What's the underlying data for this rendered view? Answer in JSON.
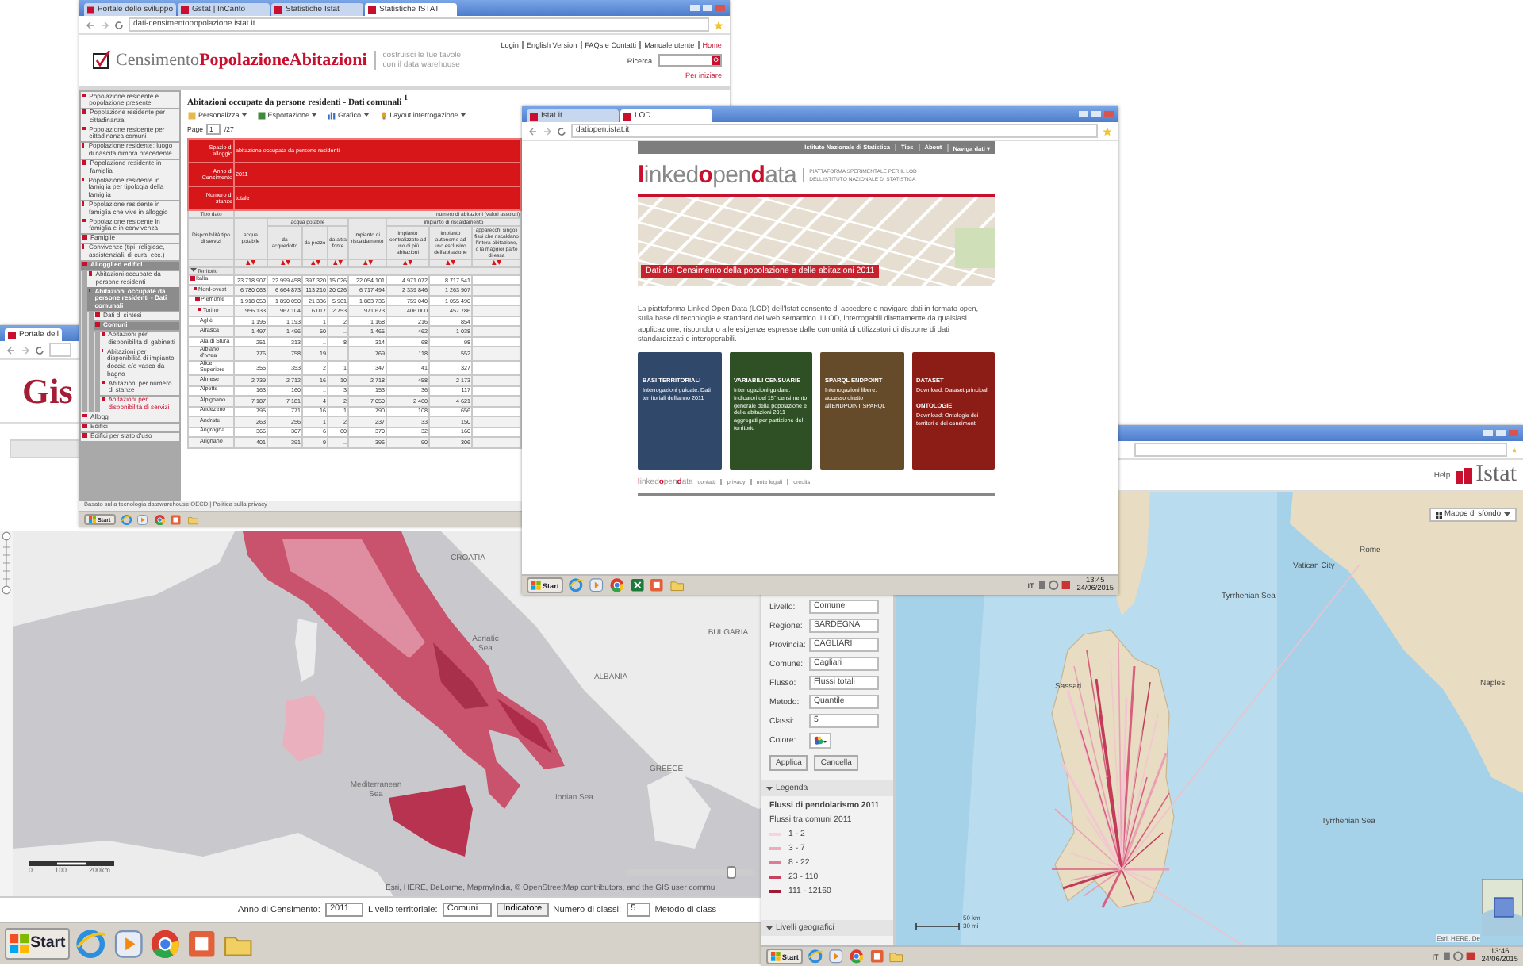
{
  "windows": [
    {
      "kind": "italy",
      "tabs": [
        {
          "label": "Portale dell",
          "selected": true
        }
      ],
      "heading": "Gis",
      "map_labels": [
        "CROATIA",
        "Adriatic Sea",
        "ALBANIA",
        "BULGARIA",
        "Mediterranean Sea",
        "Ionian Sea",
        "GREECE"
      ],
      "scale": [
        "0",
        "100",
        "200km"
      ],
      "opacity_slider": {
        "level": 0.82
      },
      "attribution": "Esri, HERE, DeLorme, MapmyIndia, © OpenStreetMap contributors, and the GIS user commu",
      "controls": [
        {
          "kind": "label",
          "text": "Anno di Censimento:"
        },
        {
          "kind": "select",
          "text": "2011"
        },
        {
          "kind": "label",
          "text": "Livello territoriale:"
        },
        {
          "kind": "select",
          "text": "Comuni"
        },
        {
          "kind": "button",
          "text": "Indicatore"
        },
        {
          "kind": "label",
          "text": "Numero di classi:"
        },
        {
          "kind": "select",
          "text": "5"
        },
        {
          "kind": "label",
          "text": "Metodo di class"
        }
      ],
      "taskbar": {
        "start": "Start",
        "apps": [
          {
            "kind": "ie"
          },
          {
            "kind": "media"
          },
          {
            "kind": "chrome"
          },
          {
            "kind": "ppt"
          },
          {
            "kind": "folder"
          }
        ]
      }
    },
    {
      "kind": "flows",
      "header_link": "Help",
      "logo": "Istat",
      "basemap_button": "Mappe di sfondo",
      "fields": [
        {
          "label": "Livello:",
          "value": "Comune"
        },
        {
          "label": "Regione:",
          "value": "SARDEGNA"
        },
        {
          "label": "Provincia:",
          "value": "CAGLIARI"
        },
        {
          "label": "Comune:",
          "value": "Cagliari"
        },
        {
          "label": "Flusso:",
          "value": "Flussi totali"
        },
        {
          "label": "Metodo:",
          "value": "Quantile"
        },
        {
          "label": "Classi:",
          "value": "5"
        }
      ],
      "color_label": "Colore:",
      "buttons": [
        "Applica",
        "Cancella"
      ],
      "legend": {
        "toggle": "Legenda",
        "title": "Flussi di pendolarismo 2011",
        "subtitle": "Flussi tra comuni 2011",
        "classes": [
          {
            "label": "1 - 2",
            "color": "#f7d3dc"
          },
          {
            "label": "3 - 7",
            "color": "#efabbb"
          },
          {
            "label": "8 - 22",
            "color": "#e07b93"
          },
          {
            "label": "23 - 110",
            "color": "#c6425e"
          },
          {
            "label": "111 - 12160",
            "color": "#9c1a37"
          }
        ]
      },
      "levels_toggle": "Livelli geografici",
      "map_labels": [
        "Vatican City",
        "Rome",
        "Naples",
        "Tyrrhenian Sea",
        "Tyrrhenian Sea",
        "Sassari"
      ],
      "scale": [
        "50 km",
        "30 mi"
      ],
      "attribution": "Esri, HERE, De",
      "taskbar": {
        "start": "Start",
        "apps": [
          {
            "kind": "ie"
          },
          {
            "kind": "media"
          },
          {
            "kind": "chrome"
          },
          {
            "kind": "ppt"
          },
          {
            "kind": "folder"
          }
        ],
        "language": "IT",
        "time": "13:46",
        "date": "24/06/2015"
      }
    },
    {
      "kind": "census",
      "tabs": [
        {
          "label": "Portale dello sviluppo",
          "selected": false
        },
        {
          "label": "Gstat | InCanto",
          "selected": false
        },
        {
          "label": "Statistiche Istat",
          "selected": false
        },
        {
          "label": "Statistiche ISTAT",
          "selected": true
        }
      ],
      "url": "dati-censimentopopolazione.istat.it",
      "logo": "Censimento**PopolazioneAbitazioni**",
      "tagline": "costruisci le tue tavole con il data warehouse",
      "top_links": [
        "Login",
        "English Version",
        "FAQs e Contatti",
        "Manuale utente",
        "Home"
      ],
      "search_label": "Ricerca",
      "start_link": "Per iniziare",
      "sidebar": [
        {
          "label": "Popolazione residente e popolazione presente",
          "selected": false
        },
        {
          "label": "Popolazione residente per cittadinanza",
          "selected": false
        },
        {
          "label": "Popolazione residente per cittadinanza comuni",
          "selected": false
        },
        {
          "label": "Popolazione residente: luogo di nascita dimora precedente",
          "selected": false
        },
        {
          "label": "Popolazione residente in famiglia",
          "selected": false
        },
        {
          "label": "Popolazione residente in famiglia per tipologia della famiglia",
          "selected": false
        },
        {
          "label": "Popolazione residente in famiglia che vive in alloggio",
          "selected": false
        },
        {
          "label": "Popolazione residente in famiglia e in convivenza",
          "selected": false
        },
        {
          "label": "Famiglie",
          "selected": false
        },
        {
          "label": "Convivenze (tipi, religiose, assistenziali, di cura, ecc.)",
          "selected": false
        },
        {
          "label": "Alloggi ed edifici",
          "selected": false,
          "children": [
            {
              "label": "Abitazioni occupate da persone residenti",
              "selected": false
            },
            {
              "label": "Abitazioni occupate da persone residenti - Dati comunali",
              "selected": false,
              "children": [
                {
                  "label": "Dati di sintesi",
                  "selected": false
                },
                {
                  "label": "Comuni",
                  "selected": false,
                  "children": [
                    {
                      "label": "Abitazioni per disponibilità di gabinetti",
                      "selected": false
                    },
                    {
                      "label": "Abitazioni per disponibilità di impianto doccia e/o vasca da bagno",
                      "selected": false
                    },
                    {
                      "label": "Abitazioni per numero di stanze",
                      "selected": false
                    },
                    {
                      "label": "Abitazioni per disponibilità di servizi",
                      "selected": true
                    }
                  ]
                }
              ]
            }
          ]
        },
        {
          "label": "Alloggi",
          "selected": false
        },
        {
          "label": "Edifici",
          "selected": false
        },
        {
          "label": "Edifici per stato d'uso",
          "selected": false
        }
      ],
      "title": "Abitazioni occupate da persone residenti - Dati comunali $^{1}$",
      "toolbar": [
        "Personalizza",
        "Esportazione",
        "Grafico",
        "Layout interrogazione"
      ],
      "page_label": "Page",
      "page": "1",
      "page_total": "/27",
      "filters": [
        {
          "label": "Spazio di alloggio",
          "value": "abitazione occupata da persone residenti"
        },
        {
          "label": "Anno di Censimento",
          "value": "2011"
        },
        {
          "label": "Numero di stanze",
          "value": "totale"
        }
      ],
      "data_type": {
        "label": "Tipo dato",
        "value": "numero di abitazioni (valori assoluti)"
      },
      "row_header": "Disponibilità tipo di servizi",
      "header": [
        {
          "kind": "single",
          "label": "acqua potabile"
        },
        {
          "kind": "group",
          "label": "acqua potabile",
          "columns": [
            "da acquedotto",
            "da pozzo",
            "da altra fonte"
          ]
        },
        {
          "kind": "single",
          "label": "impianto di riscaldamento"
        },
        {
          "kind": "group",
          "label": "impianto di riscaldamento",
          "columns": [
            "impianto centralizzato ad uso di più abitazioni",
            "impianto autonomo ad uso esclusivo dell'abitazione",
            "apparecchi singoli fissi che riscaldano l'intera abitazione, o la maggior parte di essa"
          ]
        }
      ],
      "territory_label": "Territorio",
      "rows": [
        {
          "name": "Italia",
          "values": [
            "23 718 907",
            "22 999 458",
            "397 320",
            "15 026",
            "22 054 101",
            "4 971 072",
            "8 717 541"
          ],
          "children": [
            {
              "name": "Nord-ovest",
              "values": [
                "6 780 063",
                "6 664 873",
                "113 210",
                "20 026",
                "6 717 494",
                "2 339 846",
                "1 263 907"
              ],
              "children": [
                {
                  "name": "Piemonte",
                  "values": [
                    "1 918 053",
                    "1 890 050",
                    "21 336",
                    "5 961",
                    "1 883 736",
                    "759 040",
                    "1 055 490"
                  ],
                  "children": [
                    {
                      "name": "Torino",
                      "values": [
                        "956 133",
                        "967 104",
                        "6 017",
                        "2 753",
                        "971 673",
                        "406 000",
                        "457 786"
                      ],
                      "children": [
                        {
                          "name": "Agliè",
                          "values": [
                            "1 195",
                            "1 193",
                            "1",
                            "2",
                            "1 168",
                            "216",
                            "854"
                          ]
                        },
                        {
                          "name": "Airasca",
                          "values": [
                            "1 497",
                            "1 496",
                            "50",
                            "..",
                            "1 465",
                            "462",
                            "1 038"
                          ]
                        },
                        {
                          "name": "Ala di Stura",
                          "values": [
                            "251",
                            "313",
                            "..",
                            "8",
                            "314",
                            "68",
                            "98"
                          ]
                        },
                        {
                          "name": "Albiano d'Ivrea",
                          "values": [
                            "776",
                            "758",
                            "19",
                            "..",
                            "769",
                            "118",
                            "552"
                          ]
                        },
                        {
                          "name": "Alice Superiore",
                          "values": [
                            "355",
                            "353",
                            "2",
                            "1",
                            "347",
                            "41",
                            "327"
                          ]
                        },
                        {
                          "name": "Almese",
                          "values": [
                            "2 739",
                            "2 712",
                            "16",
                            "10",
                            "2 718",
                            "458",
                            "2 173"
                          ]
                        },
                        {
                          "name": "Alpette",
                          "values": [
                            "163",
                            "160",
                            "..",
                            "3",
                            "153",
                            "36",
                            "117"
                          ]
                        },
                        {
                          "name": "Alpignano",
                          "values": [
                            "7 187",
                            "7 181",
                            "4",
                            "2",
                            "7 050",
                            "2 460",
                            "4 621"
                          ]
                        },
                        {
                          "name": "Andezeno",
                          "values": [
                            "795",
                            "771",
                            "16",
                            "1",
                            "790",
                            "108",
                            "656"
                          ]
                        },
                        {
                          "name": "Andrate",
                          "values": [
                            "263",
                            "256",
                            "1",
                            "2",
                            "237",
                            "33",
                            "150"
                          ]
                        },
                        {
                          "name": "Angrogna",
                          "values": [
                            "366",
                            "307",
                            "6",
                            "60",
                            "370",
                            "32",
                            "160"
                          ]
                        },
                        {
                          "name": "Arignano",
                          "values": [
                            "401",
                            "391",
                            "9",
                            "..",
                            "396",
                            "90",
                            "306"
                          ]
                        }
                      ]
                    }
                  ]
                }
              ]
            }
          ]
        }
      ],
      "footer": "Basato sulla tecnologia datawarehouse OECD | Politica sulla privacy",
      "taskbar": {
        "start": "Start",
        "apps": [
          {
            "kind": "ie"
          },
          {
            "kind": "media"
          },
          {
            "kind": "chrome"
          },
          {
            "kind": "ppt"
          },
          {
            "kind": "folder"
          }
        ]
      }
    },
    {
      "kind": "lod",
      "tabs": [
        {
          "label": "Istat.it",
          "selected": false
        },
        {
          "label": "LOD",
          "selected": true
        }
      ],
      "url": "datiopen.istat.it",
      "nav": [
        "Istituto Nazionale di Statistica",
        "Tips",
        "About",
        "Naviga dati ▾"
      ],
      "logo": "**l**inked**o**pen**d**ata",
      "tagline": "PIATTAFORMA SPERIMENTALE PER IL LOD DELL'ISTITUTO NAZIONALE DI STATISTICA",
      "banner": "Dati del Censimento della popolazione e delle abitazioni 2011",
      "intro": "La piattaforma Linked Open Data (LOD) dell'Istat consente di accedere e navigare dati in formato open, sulla base di tecnologie e standard del web semantico. I LOD, interrogabili direttamente da qualsiasi applicazione, rispondono alle esigenze espresse dalle comunità di utilizzatori di disporre di dati standardizzati e interoperabili.",
      "cards": [
        {
          "color": "#30486a",
          "sections": [
            {
              "title": "BASI TERRITORIALI",
              "text": "Interrogazioni guidate: Dati territoriali dell'anno 2011"
            }
          ]
        },
        {
          "color": "#2f4f24",
          "sections": [
            {
              "title": "VARIABILI CENSUARIE",
              "text": "Interrogazioni guidate: Indicatori del 15° censimento generale della popolazione e delle abitazioni 2011 aggregati per partizione del territorio"
            }
          ]
        },
        {
          "color": "#664b2a",
          "sections": [
            {
              "title": "SPARQL ENDPOINT",
              "text": "Interrogazioni libere: accesso diretto all'ENDPOINT SPARQL"
            }
          ]
        },
        {
          "color": "#8b1d16",
          "sections": [
            {
              "title": "DATASET",
              "text": "Download: Dataset principali"
            },
            {
              "title": "ONTOLOGIE",
              "text": "Download: Ontologie dei territori e dei censimenti"
            }
          ]
        }
      ],
      "footer_logo": "**l**inked**o**pen**d**ata",
      "footer_links": [
        "contatti",
        "privacy",
        "note legali",
        "credits"
      ],
      "taskbar": {
        "start": "Start",
        "apps": [
          {
            "kind": "ie"
          },
          {
            "kind": "media"
          },
          {
            "kind": "chrome"
          },
          {
            "kind": "excel"
          },
          {
            "kind": "ppt"
          },
          {
            "kind": "folder"
          }
        ],
        "language": "IT",
        "time": "13:45",
        "date": "24/06/2015"
      }
    }
  ]
}
